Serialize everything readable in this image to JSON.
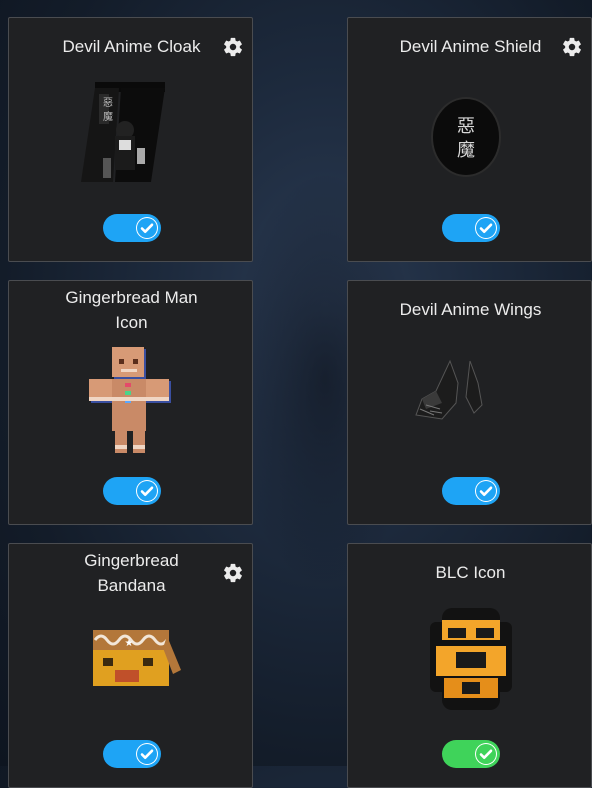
{
  "accent_blue": "#1ea4f5",
  "accent_green": "#3fd35a",
  "cards": [
    {
      "title": "Devil Anime Cloak",
      "enabled": true,
      "has_settings": true,
      "icon": "cloak-thumbnail"
    },
    {
      "title": "Devil Anime Shield",
      "enabled": true,
      "has_settings": true,
      "icon": "shield-thumbnail"
    },
    {
      "title": "Gingerbread Man Icon",
      "enabled": true,
      "has_settings": false,
      "icon": "gingerbread-man-thumbnail"
    },
    {
      "title": "Devil Anime Wings",
      "enabled": true,
      "has_settings": false,
      "icon": "wings-thumbnail"
    },
    {
      "title": "Gingerbread Bandana",
      "enabled": true,
      "has_settings": true,
      "icon": "bandana-thumbnail"
    },
    {
      "title": "BLC Icon",
      "enabled": true,
      "has_settings": false,
      "icon": "blc-icon-thumbnail"
    }
  ],
  "shield_text": "惡魔"
}
